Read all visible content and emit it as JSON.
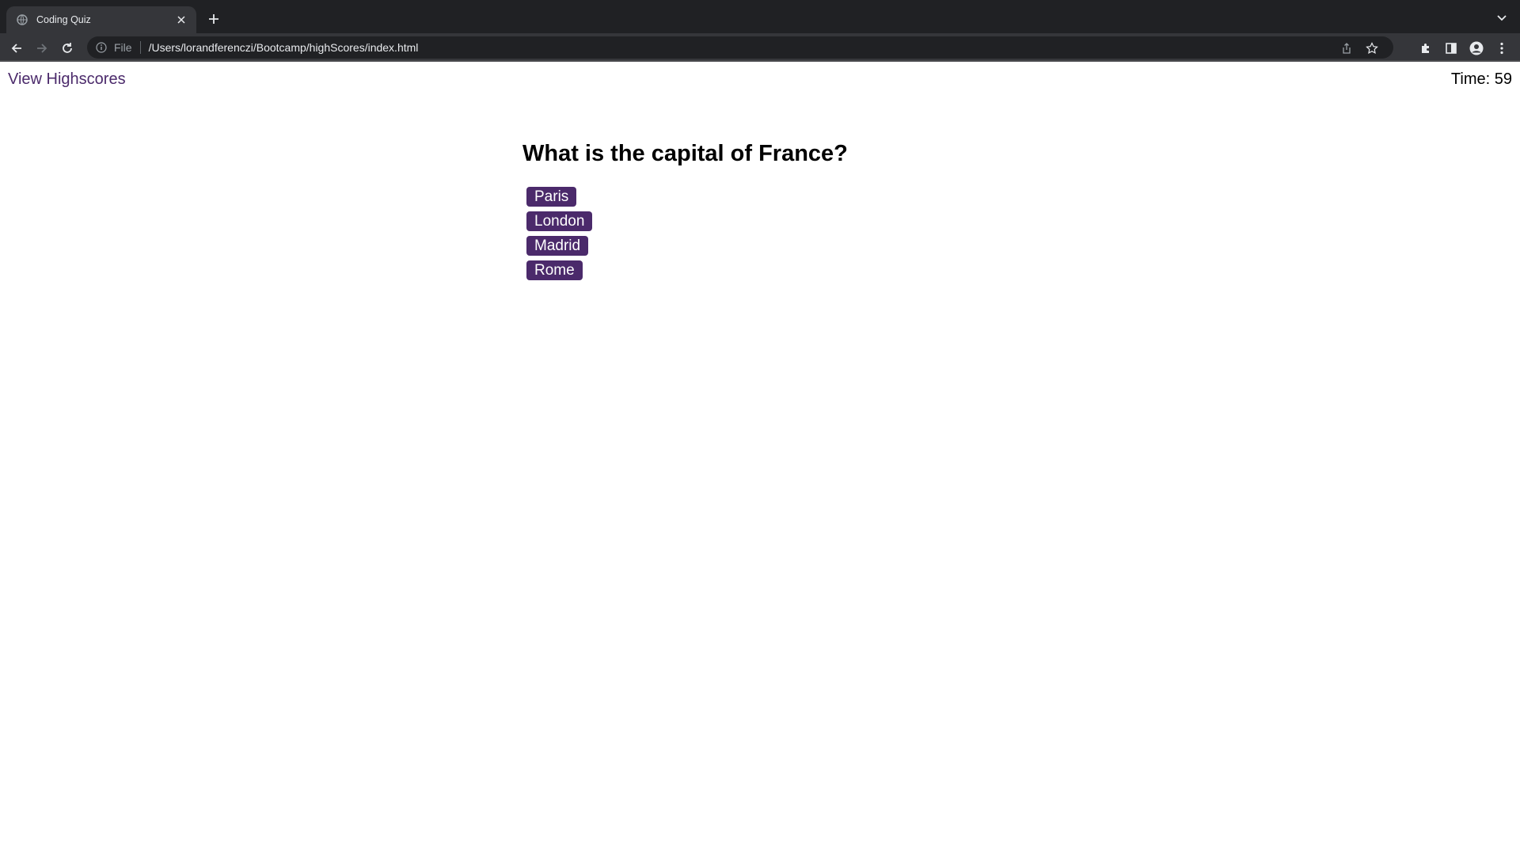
{
  "browser": {
    "tab_title": "Coding Quiz",
    "omnibox_scheme": "File",
    "omnibox_url": "/Users/lorandferenczi/Bootcamp/highScores/index.html"
  },
  "header": {
    "highscores_link": "View Highscores",
    "timer_label": "Time:",
    "timer_value": "59"
  },
  "quiz": {
    "question": "What is the capital of France?",
    "choices": [
      "Paris",
      "London",
      "Madrid",
      "Rome"
    ]
  },
  "colors": {
    "accent": "#4b2a6b",
    "chrome_dark": "#202124",
    "chrome_toolbar": "#35363a"
  }
}
